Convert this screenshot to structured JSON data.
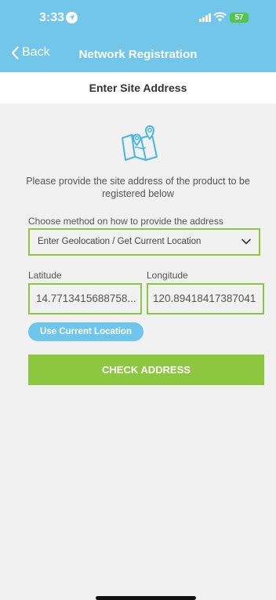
{
  "status_bar": {
    "time": "3:33",
    "battery": "57"
  },
  "nav": {
    "back_label": "Back",
    "title": "Network Registration"
  },
  "subheader": {
    "title": "Enter Site Address"
  },
  "main": {
    "instructions": "Please provide the site address of the product to be registered below",
    "method_label": "Choose method on how to provide the address",
    "method_value": "Enter Geolocation / Get Current Location",
    "latitude_label": "Latitude",
    "longitude_label": "Longitude",
    "latitude_value": "14.7713415688758...",
    "longitude_value": "120.89418417387041",
    "use_location_label": "Use Current Location",
    "check_address_label": "CHECK ADDRESS"
  },
  "colors": {
    "header": "#72c6ea",
    "accent_green": "#8dc63f",
    "pill_blue": "#6ec6ec"
  },
  "icons": [
    "location-arrow-icon",
    "signal-icon",
    "wifi-icon",
    "battery-icon",
    "chevron-left-icon",
    "map-icon",
    "chevron-down-icon"
  ]
}
